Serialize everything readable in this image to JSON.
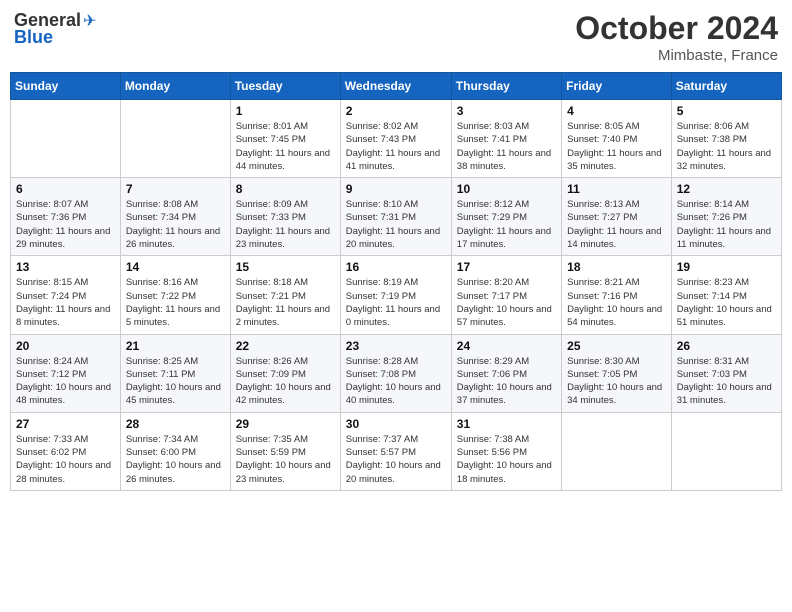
{
  "header": {
    "logo_general": "General",
    "logo_blue": "Blue",
    "month": "October 2024",
    "location": "Mimbaste, France"
  },
  "weekdays": [
    "Sunday",
    "Monday",
    "Tuesday",
    "Wednesday",
    "Thursday",
    "Friday",
    "Saturday"
  ],
  "weeks": [
    [
      {
        "day": "",
        "sunrise": "",
        "sunset": "",
        "daylight": ""
      },
      {
        "day": "",
        "sunrise": "",
        "sunset": "",
        "daylight": ""
      },
      {
        "day": "1",
        "sunrise": "Sunrise: 8:01 AM",
        "sunset": "Sunset: 7:45 PM",
        "daylight": "Daylight: 11 hours and 44 minutes."
      },
      {
        "day": "2",
        "sunrise": "Sunrise: 8:02 AM",
        "sunset": "Sunset: 7:43 PM",
        "daylight": "Daylight: 11 hours and 41 minutes."
      },
      {
        "day": "3",
        "sunrise": "Sunrise: 8:03 AM",
        "sunset": "Sunset: 7:41 PM",
        "daylight": "Daylight: 11 hours and 38 minutes."
      },
      {
        "day": "4",
        "sunrise": "Sunrise: 8:05 AM",
        "sunset": "Sunset: 7:40 PM",
        "daylight": "Daylight: 11 hours and 35 minutes."
      },
      {
        "day": "5",
        "sunrise": "Sunrise: 8:06 AM",
        "sunset": "Sunset: 7:38 PM",
        "daylight": "Daylight: 11 hours and 32 minutes."
      }
    ],
    [
      {
        "day": "6",
        "sunrise": "Sunrise: 8:07 AM",
        "sunset": "Sunset: 7:36 PM",
        "daylight": "Daylight: 11 hours and 29 minutes."
      },
      {
        "day": "7",
        "sunrise": "Sunrise: 8:08 AM",
        "sunset": "Sunset: 7:34 PM",
        "daylight": "Daylight: 11 hours and 26 minutes."
      },
      {
        "day": "8",
        "sunrise": "Sunrise: 8:09 AM",
        "sunset": "Sunset: 7:33 PM",
        "daylight": "Daylight: 11 hours and 23 minutes."
      },
      {
        "day": "9",
        "sunrise": "Sunrise: 8:10 AM",
        "sunset": "Sunset: 7:31 PM",
        "daylight": "Daylight: 11 hours and 20 minutes."
      },
      {
        "day": "10",
        "sunrise": "Sunrise: 8:12 AM",
        "sunset": "Sunset: 7:29 PM",
        "daylight": "Daylight: 11 hours and 17 minutes."
      },
      {
        "day": "11",
        "sunrise": "Sunrise: 8:13 AM",
        "sunset": "Sunset: 7:27 PM",
        "daylight": "Daylight: 11 hours and 14 minutes."
      },
      {
        "day": "12",
        "sunrise": "Sunrise: 8:14 AM",
        "sunset": "Sunset: 7:26 PM",
        "daylight": "Daylight: 11 hours and 11 minutes."
      }
    ],
    [
      {
        "day": "13",
        "sunrise": "Sunrise: 8:15 AM",
        "sunset": "Sunset: 7:24 PM",
        "daylight": "Daylight: 11 hours and 8 minutes."
      },
      {
        "day": "14",
        "sunrise": "Sunrise: 8:16 AM",
        "sunset": "Sunset: 7:22 PM",
        "daylight": "Daylight: 11 hours and 5 minutes."
      },
      {
        "day": "15",
        "sunrise": "Sunrise: 8:18 AM",
        "sunset": "Sunset: 7:21 PM",
        "daylight": "Daylight: 11 hours and 2 minutes."
      },
      {
        "day": "16",
        "sunrise": "Sunrise: 8:19 AM",
        "sunset": "Sunset: 7:19 PM",
        "daylight": "Daylight: 11 hours and 0 minutes."
      },
      {
        "day": "17",
        "sunrise": "Sunrise: 8:20 AM",
        "sunset": "Sunset: 7:17 PM",
        "daylight": "Daylight: 10 hours and 57 minutes."
      },
      {
        "day": "18",
        "sunrise": "Sunrise: 8:21 AM",
        "sunset": "Sunset: 7:16 PM",
        "daylight": "Daylight: 10 hours and 54 minutes."
      },
      {
        "day": "19",
        "sunrise": "Sunrise: 8:23 AM",
        "sunset": "Sunset: 7:14 PM",
        "daylight": "Daylight: 10 hours and 51 minutes."
      }
    ],
    [
      {
        "day": "20",
        "sunrise": "Sunrise: 8:24 AM",
        "sunset": "Sunset: 7:12 PM",
        "daylight": "Daylight: 10 hours and 48 minutes."
      },
      {
        "day": "21",
        "sunrise": "Sunrise: 8:25 AM",
        "sunset": "Sunset: 7:11 PM",
        "daylight": "Daylight: 10 hours and 45 minutes."
      },
      {
        "day": "22",
        "sunrise": "Sunrise: 8:26 AM",
        "sunset": "Sunset: 7:09 PM",
        "daylight": "Daylight: 10 hours and 42 minutes."
      },
      {
        "day": "23",
        "sunrise": "Sunrise: 8:28 AM",
        "sunset": "Sunset: 7:08 PM",
        "daylight": "Daylight: 10 hours and 40 minutes."
      },
      {
        "day": "24",
        "sunrise": "Sunrise: 8:29 AM",
        "sunset": "Sunset: 7:06 PM",
        "daylight": "Daylight: 10 hours and 37 minutes."
      },
      {
        "day": "25",
        "sunrise": "Sunrise: 8:30 AM",
        "sunset": "Sunset: 7:05 PM",
        "daylight": "Daylight: 10 hours and 34 minutes."
      },
      {
        "day": "26",
        "sunrise": "Sunrise: 8:31 AM",
        "sunset": "Sunset: 7:03 PM",
        "daylight": "Daylight: 10 hours and 31 minutes."
      }
    ],
    [
      {
        "day": "27",
        "sunrise": "Sunrise: 7:33 AM",
        "sunset": "Sunset: 6:02 PM",
        "daylight": "Daylight: 10 hours and 28 minutes."
      },
      {
        "day": "28",
        "sunrise": "Sunrise: 7:34 AM",
        "sunset": "Sunset: 6:00 PM",
        "daylight": "Daylight: 10 hours and 26 minutes."
      },
      {
        "day": "29",
        "sunrise": "Sunrise: 7:35 AM",
        "sunset": "Sunset: 5:59 PM",
        "daylight": "Daylight: 10 hours and 23 minutes."
      },
      {
        "day": "30",
        "sunrise": "Sunrise: 7:37 AM",
        "sunset": "Sunset: 5:57 PM",
        "daylight": "Daylight: 10 hours and 20 minutes."
      },
      {
        "day": "31",
        "sunrise": "Sunrise: 7:38 AM",
        "sunset": "Sunset: 5:56 PM",
        "daylight": "Daylight: 10 hours and 18 minutes."
      },
      {
        "day": "",
        "sunrise": "",
        "sunset": "",
        "daylight": ""
      },
      {
        "day": "",
        "sunrise": "",
        "sunset": "",
        "daylight": ""
      }
    ]
  ]
}
